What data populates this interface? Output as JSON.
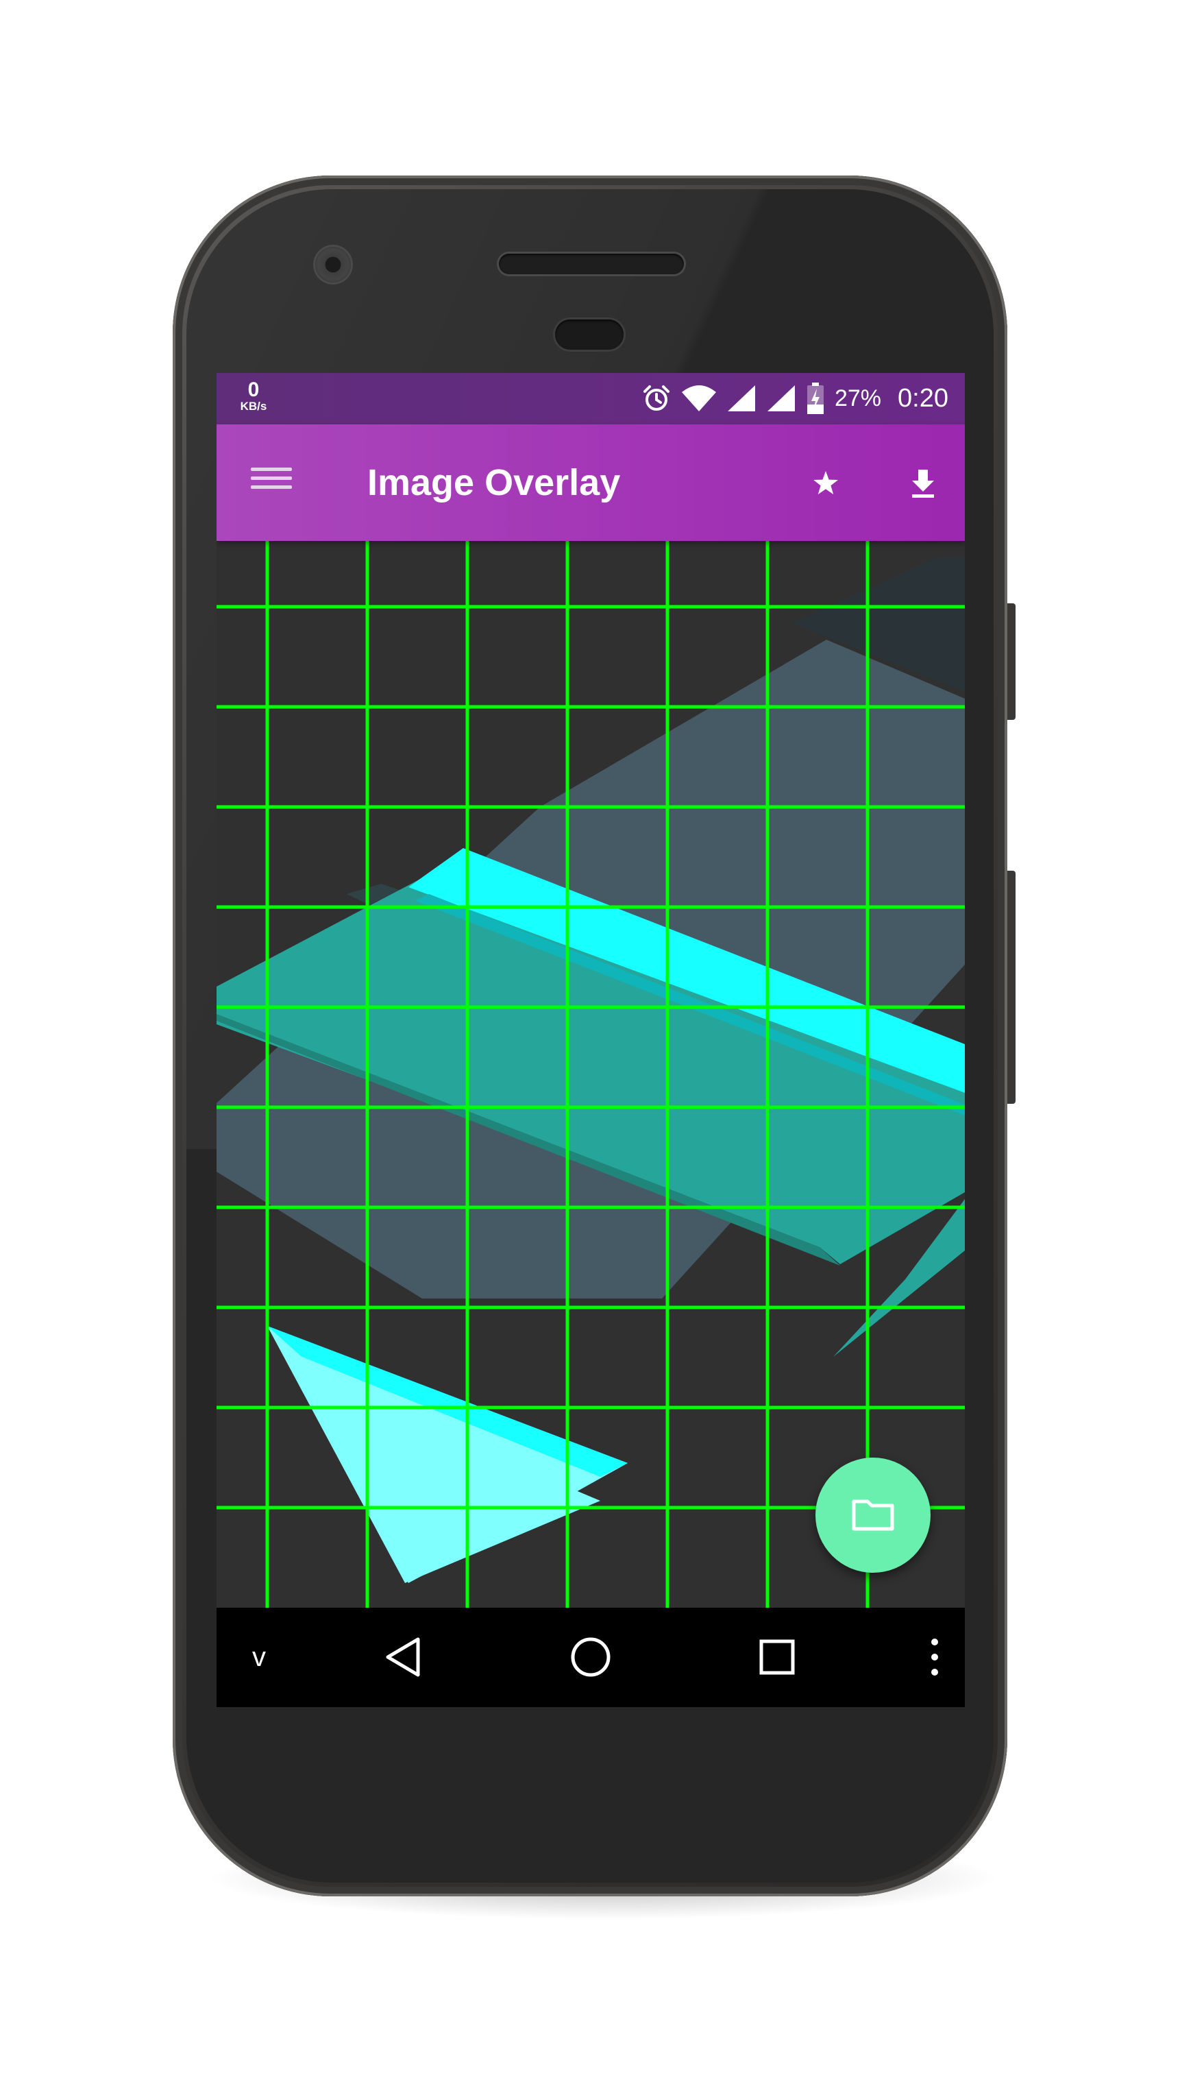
{
  "status_bar": {
    "network_speed_value": "0",
    "network_speed_unit": "KB/s",
    "battery_percent": "27%",
    "time": "0:20",
    "icons": [
      "alarm-icon",
      "wifi-icon",
      "signal-icon",
      "signal-icon",
      "battery-charging-icon"
    ]
  },
  "app_bar": {
    "title": "Image Overlay",
    "menu_icon": "hamburger-menu-icon",
    "actions": [
      "star-icon",
      "download-icon"
    ]
  },
  "overlay": {
    "grid_color": "#00ff00",
    "grid_columns": 8,
    "grid_rows": 11
  },
  "fab": {
    "icon": "folder-icon",
    "color": "#69f0ae"
  },
  "nav_bar": {
    "left_label": "v",
    "icons": [
      "back-icon",
      "home-icon",
      "recents-icon",
      "overflow-menu-icon"
    ]
  },
  "colors": {
    "status_bar": "#6a2a88",
    "app_bar": "#9c27b0",
    "accent": "#00ff00",
    "cyan": "#18ffff",
    "teal": "#26a69a",
    "slate": "#455a64"
  }
}
